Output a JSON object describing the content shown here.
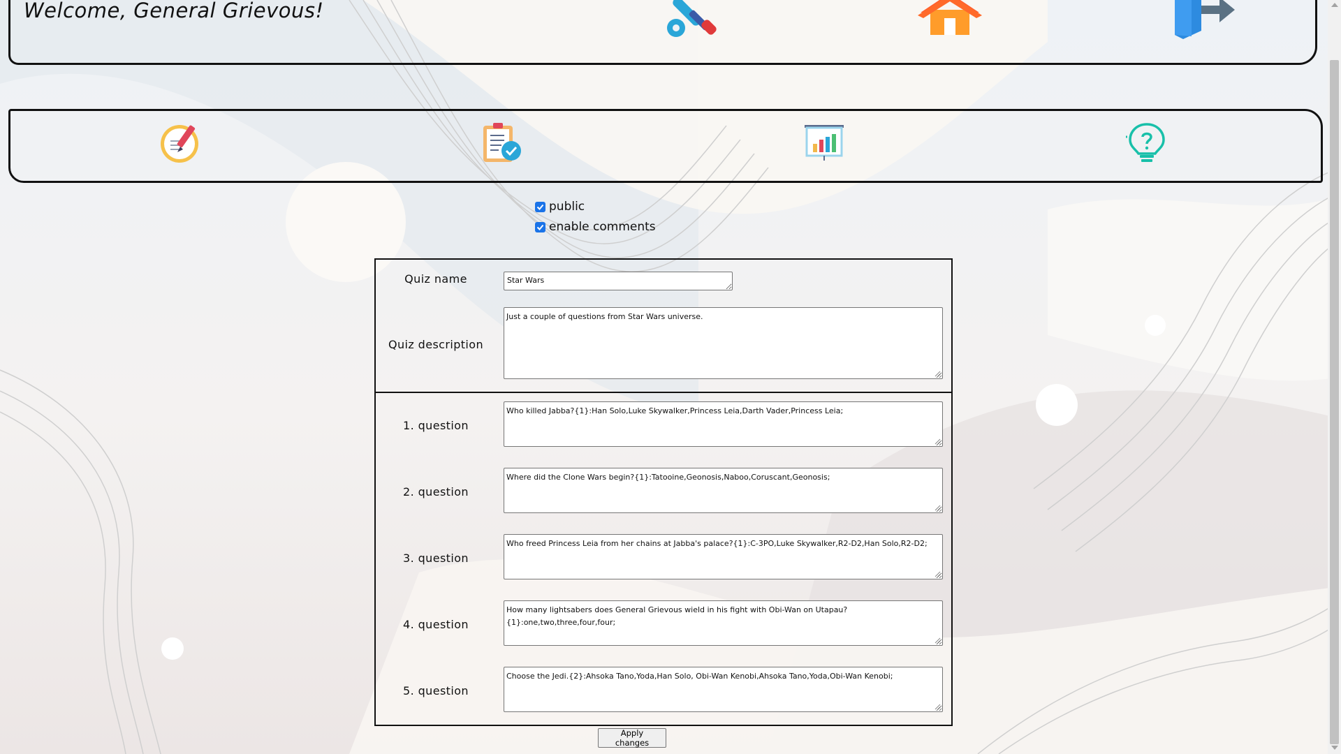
{
  "header": {
    "welcome_text": "Welcome, General Grievous!"
  },
  "top_icons": [
    {
      "name": "tools-icon"
    },
    {
      "name": "home-icon"
    },
    {
      "name": "logout-icon"
    }
  ],
  "nav_icons": [
    {
      "name": "create-quiz-icon"
    },
    {
      "name": "quiz-checklist-icon"
    },
    {
      "name": "statistics-chart-icon"
    },
    {
      "name": "lightbulb-help-icon"
    }
  ],
  "options": {
    "public_label": "public",
    "public_checked": true,
    "comments_label": "enable comments",
    "comments_checked": true
  },
  "form": {
    "quiz_name_label": "Quiz name",
    "quiz_name_value": "Star Wars",
    "quiz_description_label": "Quiz description",
    "quiz_description_value": "Just a couple of questions from Star Wars universe.",
    "questions": [
      {
        "label": "1. question",
        "value": "Who killed Jabba?{1}:Han Solo,Luke Skywalker,Princess Leia,Darth Vader,Princess Leia;"
      },
      {
        "label": "2. question",
        "value": "Where did the Clone Wars begin?{1}:Tatooine,Geonosis,Naboo,Coruscant,Geonosis;"
      },
      {
        "label": "3. question",
        "value": "Who freed Princess Leia from her chains at Jabba's palace?{1}:C-3PO,Luke Skywalker,R2-D2,Han Solo,R2-D2;"
      },
      {
        "label": "4. question",
        "value": "How many lightsabers does General Grievous wield in his fight with Obi-Wan on Utapau?{1}:one,two,three,four,four;"
      },
      {
        "label": "5. question",
        "value": "Choose the Jedi.{2}:Ahsoka Tano,Yoda,Han Solo, Obi-Wan Kenobi,Ahsoka Tano,Yoda,Obi-Wan Kenobi;"
      }
    ]
  },
  "apply_button_label": "Apply changes",
  "colors": {
    "checkbox_accent": "#1a73e8",
    "border": "#111111"
  }
}
